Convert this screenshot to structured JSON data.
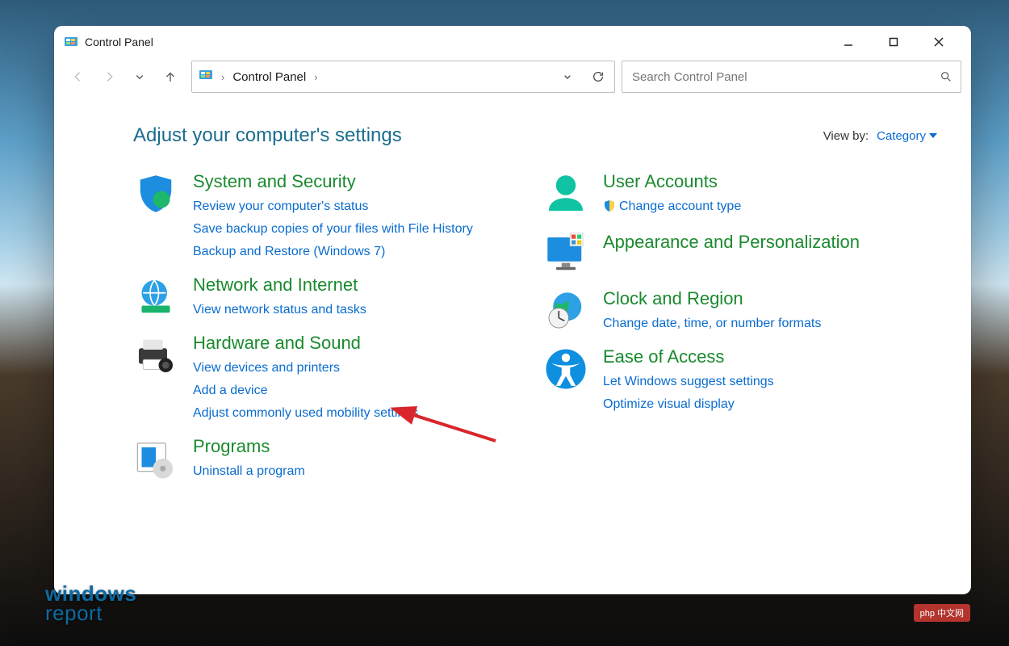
{
  "window": {
    "title": "Control Panel"
  },
  "breadcrumb": {
    "root": "Control Panel"
  },
  "search": {
    "placeholder": "Search Control Panel"
  },
  "header": {
    "title": "Adjust your computer's settings",
    "view_by_label": "View by:",
    "view_by_value": "Category"
  },
  "categories": {
    "system_security": {
      "title": "System and Security",
      "links": [
        "Review your computer's status",
        "Save backup copies of your files with File History",
        "Backup and Restore (Windows 7)"
      ]
    },
    "network": {
      "title": "Network and Internet",
      "links": [
        "View network status and tasks"
      ]
    },
    "hardware": {
      "title": "Hardware and Sound",
      "links": [
        "View devices and printers",
        "Add a device",
        "Adjust commonly used mobility settings"
      ]
    },
    "programs": {
      "title": "Programs",
      "links": [
        "Uninstall a program"
      ]
    },
    "user_accounts": {
      "title": "User Accounts",
      "links": [
        "Change account type"
      ]
    },
    "appearance": {
      "title": "Appearance and Personalization",
      "links": []
    },
    "clock": {
      "title": "Clock and Region",
      "links": [
        "Change date, time, or number formats"
      ]
    },
    "ease": {
      "title": "Ease of Access",
      "links": [
        "Let Windows suggest settings",
        "Optimize visual display"
      ]
    }
  },
  "watermark": {
    "line1": "windows",
    "line2": "report"
  },
  "badge": "php 中文网"
}
